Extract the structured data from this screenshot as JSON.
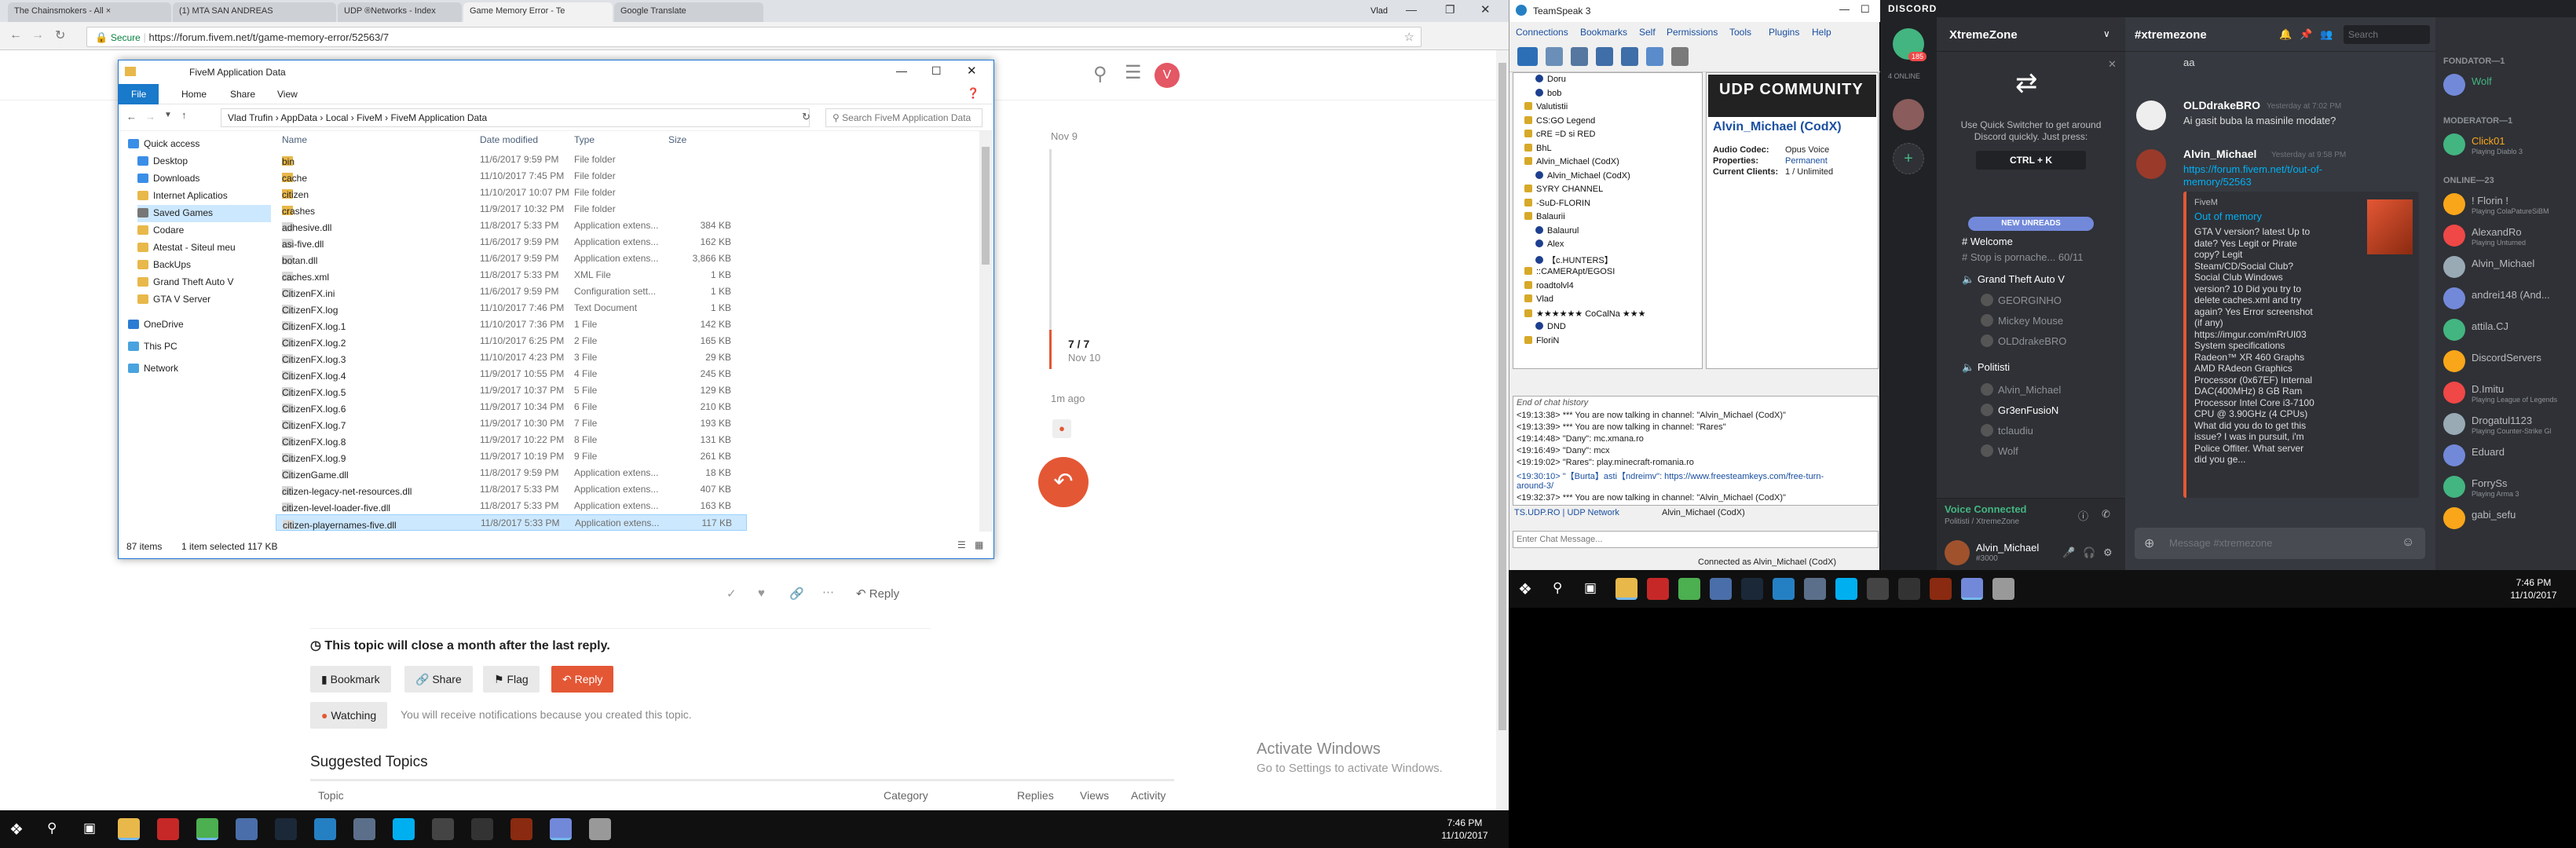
{
  "chrome": {
    "tabs": [
      {
        "label": "The Chainsmokers - All ×"
      },
      {
        "label": "(1) MTA SAN ANDREAS"
      },
      {
        "label": "UDP ®Networks - Index"
      },
      {
        "label": "Game Memory Error - Te"
      },
      {
        "label": "Google Translate"
      }
    ],
    "profile": "Vlad",
    "secure_label": "Secure",
    "url": "https://forum.fivem.net/t/game-memory-error/52563/7",
    "avatar_letter": "V",
    "timeline": {
      "date_top": "Nov 9",
      "position": "7 / 7",
      "date_bottom": "Nov 10",
      "ago": "1m ago"
    },
    "post_actions": {
      "reply": "Reply"
    },
    "close_notice": "This topic will close a month after the last reply.",
    "buttons": {
      "bookmark": "Bookmark",
      "share": "Share",
      "flag": "Flag",
      "reply": "Reply",
      "watching": "Watching"
    },
    "watching_text": "You will receive notifications because you created this topic.",
    "suggested_title": "Suggested Topics",
    "suggested_cols": {
      "topic": "Topic",
      "category": "Category",
      "replies": "Replies",
      "views": "Views",
      "activity": "Activity"
    },
    "activate_title": "Activate Windows",
    "activate_sub": "Go to Settings to activate Windows."
  },
  "explorer": {
    "title": "FiveM Application Data",
    "ribbon_tabs": [
      "File",
      "Home",
      "Share",
      "View"
    ],
    "breadcrumb": [
      "Vlad Trufin",
      "AppData",
      "Local",
      "FiveM",
      "FiveM Application Data"
    ],
    "search_placeholder": "Search FiveM Application Data",
    "sidebar": [
      {
        "label": "Quick access"
      },
      {
        "label": "Desktop"
      },
      {
        "label": "Downloads"
      },
      {
        "label": "Internet Aplicatios"
      },
      {
        "label": "Saved Games"
      },
      {
        "label": "Codare"
      },
      {
        "label": "Atestat - Siteul meu"
      },
      {
        "label": "BackUps"
      },
      {
        "label": "Grand Theft Auto V"
      },
      {
        "label": "GTA V Server"
      },
      {
        "label": "OneDrive"
      },
      {
        "label": "This PC"
      },
      {
        "label": "Network"
      }
    ],
    "columns": {
      "name": "Name",
      "date": "Date modified",
      "type": "Type",
      "size": "Size"
    },
    "files": [
      {
        "name": "bin",
        "date": "11/6/2017 9:59 PM",
        "type": "File folder",
        "size": ""
      },
      {
        "name": "cache",
        "date": "11/10/2017 7:45 PM",
        "type": "File folder",
        "size": ""
      },
      {
        "name": "citizen",
        "date": "11/10/2017 10:07 PM",
        "type": "File folder",
        "size": ""
      },
      {
        "name": "crashes",
        "date": "11/9/2017 10:32 PM",
        "type": "File folder",
        "size": ""
      },
      {
        "name": "adhesive.dll",
        "date": "11/8/2017 5:33 PM",
        "type": "Application extens...",
        "size": "384 KB"
      },
      {
        "name": "asi-five.dll",
        "date": "11/6/2017 9:59 PM",
        "type": "Application extens...",
        "size": "162 KB"
      },
      {
        "name": "botan.dll",
        "date": "11/6/2017 9:59 PM",
        "type": "Application extens...",
        "size": "3,866 KB"
      },
      {
        "name": "caches.xml",
        "date": "11/8/2017 5:33 PM",
        "type": "XML File",
        "size": "1 KB"
      },
      {
        "name": "CitizenFX.ini",
        "date": "11/6/2017 9:59 PM",
        "type": "Configuration sett...",
        "size": "1 KB"
      },
      {
        "name": "CitizenFX.log",
        "date": "11/10/2017 7:46 PM",
        "type": "Text Document",
        "size": "1 KB"
      },
      {
        "name": "CitizenFX.log.1",
        "date": "11/10/2017 7:36 PM",
        "type": "1 File",
        "size": "142 KB"
      },
      {
        "name": "CitizenFX.log.2",
        "date": "11/10/2017 6:25 PM",
        "type": "2 File",
        "size": "165 KB"
      },
      {
        "name": "CitizenFX.log.3",
        "date": "11/10/2017 4:23 PM",
        "type": "3 File",
        "size": "29 KB"
      },
      {
        "name": "CitizenFX.log.4",
        "date": "11/9/2017 10:55 PM",
        "type": "4 File",
        "size": "245 KB"
      },
      {
        "name": "CitizenFX.log.5",
        "date": "11/9/2017 10:37 PM",
        "type": "5 File",
        "size": "129 KB"
      },
      {
        "name": "CitizenFX.log.6",
        "date": "11/9/2017 10:34 PM",
        "type": "6 File",
        "size": "210 KB"
      },
      {
        "name": "CitizenFX.log.7",
        "date": "11/9/2017 10:30 PM",
        "type": "7 File",
        "size": "193 KB"
      },
      {
        "name": "CitizenFX.log.8",
        "date": "11/9/2017 10:22 PM",
        "type": "8 File",
        "size": "131 KB"
      },
      {
        "name": "CitizenFX.log.9",
        "date": "11/9/2017 10:19 PM",
        "type": "9 File",
        "size": "261 KB"
      },
      {
        "name": "CitizenGame.dll",
        "date": "11/8/2017 9:59 PM",
        "type": "Application extens...",
        "size": "18 KB"
      },
      {
        "name": "citizen-legacy-net-resources.dll",
        "date": "11/8/2017 5:33 PM",
        "type": "Application extens...",
        "size": "407 KB"
      },
      {
        "name": "citizen-level-loader-five.dll",
        "date": "11/8/2017 5:33 PM",
        "type": "Application extens...",
        "size": "163 KB"
      },
      {
        "name": "citizen-playernames-five.dll",
        "date": "11/8/2017 5:33 PM",
        "type": "Application extens...",
        "size": "117 KB"
      }
    ],
    "status_items": "87 items",
    "status_selected": "1 item selected  117 KB"
  },
  "teamspeak": {
    "title": "TeamSpeak 3",
    "menu": [
      "Connections",
      "Bookmarks",
      "Self",
      "Permissions",
      "Tools",
      "Plugins",
      "Help"
    ],
    "tree": [
      {
        "label": "Doru",
        "kind": "user",
        "indent": 2
      },
      {
        "label": "bob",
        "kind": "user",
        "indent": 2
      },
      {
        "label": "Valutistii",
        "kind": "channel",
        "indent": 1
      },
      {
        "label": "CS:GO Legend",
        "kind": "channel",
        "indent": 1
      },
      {
        "label": "cRE =D si RED",
        "kind": "channel",
        "indent": 1
      },
      {
        "label": "BhL",
        "kind": "channel",
        "indent": 1
      },
      {
        "label": "Alvin_Michael (CodX)",
        "kind": "channel",
        "indent": 1
      },
      {
        "label": "Alvin_Michael (CodX)",
        "kind": "user",
        "indent": 2
      },
      {
        "label": "SYRY CHANNEL",
        "kind": "channel",
        "indent": 1
      },
      {
        "label": "-SuD-FLORIN",
        "kind": "channel",
        "indent": 1
      },
      {
        "label": "Balaurii",
        "kind": "channel",
        "indent": 1
      },
      {
        "label": "Balaurul",
        "kind": "user",
        "indent": 2
      },
      {
        "label": "Alex",
        "kind": "user",
        "indent": 2
      },
      {
        "label": "【c.HUNTERS】",
        "kind": "user",
        "indent": 2
      },
      {
        "label": "::CAMERApt/EGOSI",
        "kind": "channel",
        "indent": 1
      },
      {
        "label": "roadtolvl4",
        "kind": "channel",
        "indent": 1
      },
      {
        "label": "Vlad",
        "kind": "channel",
        "indent": 1
      },
      {
        "label": "★★★★★★ CoCalNa ★★★",
        "kind": "channel",
        "indent": 1
      },
      {
        "label": "DND",
        "kind": "user",
        "indent": 2
      },
      {
        "label": "FloriN",
        "kind": "channel",
        "indent": 1
      }
    ],
    "banner": "UDP COMMUNITY",
    "info_name": "Alvin_Michael (CodX)",
    "info": [
      {
        "k": "Audio Codec:",
        "v": "Opus Voice"
      },
      {
        "k": "Properties:",
        "v": "Permanent"
      },
      {
        "k": "Current Clients:",
        "v": "1 / Unlimited"
      }
    ],
    "chat_header": "End of chat history",
    "chat": [
      "<19:13:38> *** You are now talking in channel: \"Alvin_Michael (CodX)\"",
      "<19:13:39> *** You are now talking in channel: \"Rares\"",
      "<19:14:48> \"Dany\": mc.xmana.ro",
      "<19:16:49> \"Dany\": mcx",
      "<19:19:02> \"Rares\": play.minecraft-romania.ro",
      "<19:30:10> \"【Burta】asti【ndreimv\": https://www.freesteamkeys.com/free-turn-",
      "around-3/",
      "<19:32:37> *** You are now talking in channel: \"Alvin_Michael (CodX)\""
    ],
    "chat_tabs": [
      "TS.UDP.RO | UDP Network",
      "Alvin_Michael (CodX)"
    ],
    "input_placeholder": "Enter Chat Message...",
    "status": "Connected as Alvin_Michael (CodX)"
  },
  "discord": {
    "title": "DISCORD",
    "server_name": "XtremeZone",
    "online_label": "4 ONLINE",
    "badge": "185",
    "switcher_text": "Use Quick Switcher to get around Discord quickly. Just press:",
    "switcher_key": "CTRL + K",
    "new_unreads": "NEW UNREADS",
    "channels": [
      {
        "label": "Welcome"
      },
      {
        "label": "Stop is pornache... 60/11"
      },
      {
        "label": "Grand Theft Auto V"
      },
      {
        "label": "GEORGINHO"
      },
      {
        "label": "Mickey Mouse"
      },
      {
        "label": "OLDdrakeBRO"
      },
      {
        "label": "Politisti"
      },
      {
        "label": "Alvin_Michael"
      },
      {
        "label": "Gr3enFusioN"
      },
      {
        "label": "tclaudiu"
      },
      {
        "label": "Wolf"
      }
    ],
    "voice_connected": "Voice Connected",
    "voice_sub": "Politisti / XtremeZone",
    "user_name": "Alvin_Michael",
    "user_tag": "#3000",
    "channel_name": "#xtremezone",
    "search_placeholder": "Search",
    "messages": [
      {
        "name": "",
        "ts": "",
        "text": "aa"
      },
      {
        "name": "OLDdrakeBRO",
        "ts": "Yesterday at 7:02 PM",
        "text": "Ai gasit buba la masinile modate?"
      },
      {
        "name": "Alvin_Michael",
        "ts": "Yesterday at 9:58 PM",
        "text": "https://forum.fivem.net/t/out-of-memory/52563"
      }
    ],
    "embed_site": "FiveM",
    "embed_title": "Out of memory",
    "embed_lines": [
      "GTA V version? latest Up to",
      "date? Yes Legit or Pirate",
      "copy? Legit",
      "Steam/CD/Social Club?",
      "Social Club Windows",
      "version? 10 Did you try to",
      "delete caches.xml and try",
      "again? Yes Error screenshot",
      "(if any)",
      "https://imgur.com/mRrUI03",
      "System specifications",
      "Radeon™ XR 460 Graphs",
      "AMD RAdeon Graphics",
      "Processor (0x67EF) Internal",
      "DAC(400MHz) 8 GB Ram",
      "Processor Intel Core i3-7100",
      "CPU @ 3.90GHz (4 CPUs)",
      "What did you do to get this",
      "issue? I was in pursuit, i'm",
      "Police Offiter. What server",
      "did you ge..."
    ],
    "message_placeholder": "Message #xtremezone",
    "member_groups": [
      {
        "header": "FONDATOR—1",
        "members": [
          {
            "name": "Wolf",
            "game": ""
          }
        ]
      },
      {
        "header": "MODERATOR—1",
        "members": [
          {
            "name": "Click01",
            "game": "Playing Diablo 3"
          }
        ]
      },
      {
        "header": "ONLINE—23",
        "members": [
          {
            "name": "! Florin !",
            "game": "Playing ColaPatureSiBM"
          },
          {
            "name": "AlexandRo",
            "game": "Playing Unturned"
          },
          {
            "name": "Alvin_Michael",
            "game": ""
          },
          {
            "name": "andrei148 (And...",
            "game": ""
          },
          {
            "name": "attila.CJ",
            "game": ""
          },
          {
            "name": "DiscordServers",
            "game": ""
          },
          {
            "name": "D.Imitu",
            "game": "Playing League of Legends"
          },
          {
            "name": "Drogatul1123",
            "game": "Playing Counter-Strike Gl"
          },
          {
            "name": "Eduard",
            "game": ""
          },
          {
            "name": "ForrySs",
            "game": "Playing Arma 3"
          },
          {
            "name": "gabi_sefu",
            "game": ""
          }
        ]
      }
    ]
  },
  "taskbar_left": {
    "time": "7:46 PM",
    "date": "11/10/2017"
  },
  "taskbar_right": {
    "time": "7:46 PM",
    "date": "11/10/2017"
  },
  "colors": {
    "accent": "#e45735",
    "win_blue": "#1979ca",
    "discord_bg": "#36393f",
    "link": "#00b0f4"
  }
}
